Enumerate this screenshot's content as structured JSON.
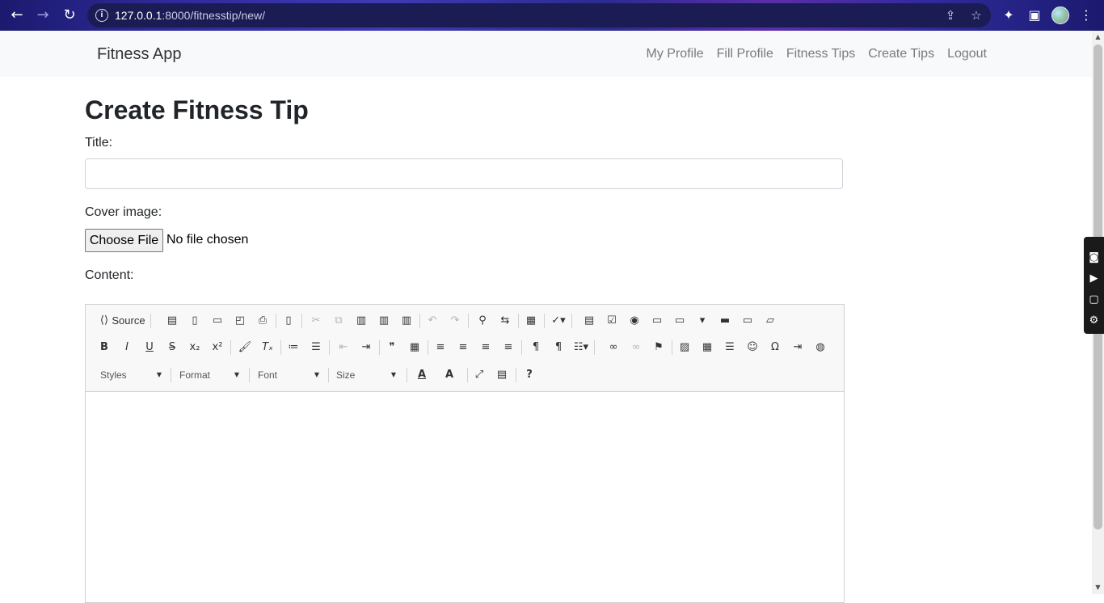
{
  "browser": {
    "url_host": "127.0.0.1",
    "url_rest": ":8000/fitnesstip/new/",
    "back_icon": "←",
    "forward_icon": "→",
    "reload_icon": "↻",
    "info_icon": "i",
    "share_icon": "⇪",
    "bookmark_icon": "☆",
    "extensions_icon": "✦",
    "sidepanel_icon": "▣",
    "menu_icon": "⋮"
  },
  "navbar": {
    "brand": "Fitness App",
    "links": [
      "My Profile",
      "Fill Profile",
      "Fitness Tips",
      "Create Tips",
      "Logout"
    ]
  },
  "form": {
    "heading": "Create Fitness Tip",
    "title_label": "Title:",
    "title_value": "",
    "cover_label": "Cover image:",
    "choose_file_label": "Choose File",
    "file_status": "No file chosen",
    "content_label": "Content:"
  },
  "editor": {
    "source_label": "Source",
    "source_icon": "⟨⟩",
    "row1": [
      {
        "name": "save-icon",
        "g": "▤"
      },
      {
        "name": "new-page-icon",
        "g": "▯"
      },
      {
        "name": "export-pdf-icon",
        "g": "▭"
      },
      {
        "name": "preview-icon",
        "g": "◰"
      },
      {
        "name": "print-icon",
        "g": "⎙"
      },
      {
        "name": "templates-icon",
        "g": "▯"
      },
      {
        "name": "cut-icon",
        "g": "✂",
        "dis": true
      },
      {
        "name": "copy-icon",
        "g": "⧉",
        "dis": true
      },
      {
        "name": "paste-icon",
        "g": "▥"
      },
      {
        "name": "paste-text-icon",
        "g": "▥"
      },
      {
        "name": "paste-word-icon",
        "g": "▥"
      },
      {
        "name": "undo-icon",
        "g": "↶",
        "dis": true
      },
      {
        "name": "redo-icon",
        "g": "↷",
        "dis": true
      },
      {
        "name": "find-icon",
        "g": "⚲"
      },
      {
        "name": "replace-icon",
        "g": "⇆"
      },
      {
        "name": "select-all-icon",
        "g": "▦"
      },
      {
        "name": "spellcheck-icon",
        "g": "✓▾"
      },
      {
        "name": "form-icon",
        "g": "▤"
      },
      {
        "name": "checkbox-icon",
        "g": "☑"
      },
      {
        "name": "radio-icon",
        "g": "◉"
      },
      {
        "name": "textfield-icon",
        "g": "▭"
      },
      {
        "name": "textarea-icon",
        "g": "▭"
      },
      {
        "name": "select-icon",
        "g": "▾"
      },
      {
        "name": "button-icon",
        "g": "▬"
      },
      {
        "name": "image-button-icon",
        "g": "▭"
      },
      {
        "name": "hidden-field-icon",
        "g": "▱"
      }
    ],
    "row2": [
      {
        "name": "bold-icon",
        "g": "B"
      },
      {
        "name": "italic-icon",
        "g": "I"
      },
      {
        "name": "underline-icon",
        "g": "U"
      },
      {
        "name": "strike-icon",
        "g": "S"
      },
      {
        "name": "subscript-icon",
        "g": "x₂"
      },
      {
        "name": "superscript-icon",
        "g": "x²"
      },
      {
        "name": "copy-format-icon",
        "g": "🖌"
      },
      {
        "name": "remove-format-icon",
        "g": "Tₓ"
      },
      {
        "name": "numbered-list-icon",
        "g": "≔"
      },
      {
        "name": "bulleted-list-icon",
        "g": "☰"
      },
      {
        "name": "outdent-icon",
        "g": "⇤",
        "dis": true
      },
      {
        "name": "indent-icon",
        "g": "⇥"
      },
      {
        "name": "blockquote-icon",
        "g": "❞"
      },
      {
        "name": "div-icon",
        "g": "▦"
      },
      {
        "name": "align-left-icon",
        "g": "≡"
      },
      {
        "name": "align-center-icon",
        "g": "≡"
      },
      {
        "name": "align-right-icon",
        "g": "≡"
      },
      {
        "name": "justify-icon",
        "g": "≡"
      },
      {
        "name": "ltr-icon",
        "g": "¶"
      },
      {
        "name": "rtl-icon",
        "g": "¶"
      },
      {
        "name": "language-icon",
        "g": "☷▾"
      },
      {
        "name": "link-icon",
        "g": "∞"
      },
      {
        "name": "unlink-icon",
        "g": "∞",
        "dis": true
      },
      {
        "name": "anchor-icon",
        "g": "⚑"
      },
      {
        "name": "image-icon",
        "g": "▨"
      },
      {
        "name": "table-icon",
        "g": "▦"
      },
      {
        "name": "horizontal-line-icon",
        "g": "☰"
      },
      {
        "name": "smiley-icon",
        "g": "☺"
      },
      {
        "name": "special-char-icon",
        "g": "Ω"
      },
      {
        "name": "page-break-icon",
        "g": "⇥"
      },
      {
        "name": "iframe-icon",
        "g": "◍"
      }
    ],
    "combos": [
      "Styles",
      "Format",
      "Font",
      "Size"
    ],
    "text_color_icon": "A",
    "bg_color_icon": "A",
    "maximize_icon": "⤢",
    "show_blocks_icon": "▤",
    "about_icon": "?"
  },
  "recorder": {
    "camera_icon": "◙",
    "video_icon": "▶",
    "window_icon": "▢",
    "settings_icon": "⚙"
  },
  "scrollbar": {
    "up_icon": "▲",
    "down_icon": "▼"
  }
}
